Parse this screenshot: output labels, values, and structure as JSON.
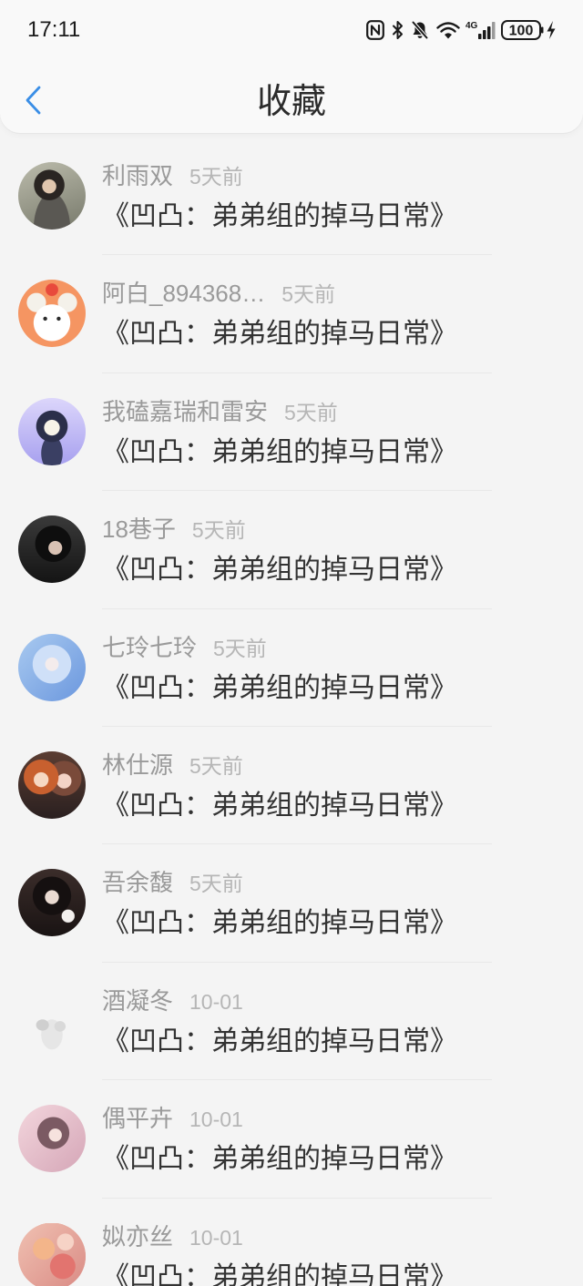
{
  "status_bar": {
    "time": "17:11",
    "network_label": "4G",
    "battery_level": "100",
    "icons": [
      "nfc-icon",
      "bluetooth-icon",
      "bell-mute-icon",
      "wifi-icon",
      "cell-signal-icon",
      "battery-icon",
      "charging-bolt-icon"
    ]
  },
  "header": {
    "title": "收藏",
    "back_icon": "chevron-left-icon"
  },
  "list": {
    "items": [
      {
        "name": "利雨双",
        "time": "5天前",
        "title": "《凹凸：弟弟组的掉马日常》"
      },
      {
        "name": "阿白_894368…",
        "time": "5天前",
        "title": "《凹凸：弟弟组的掉马日常》"
      },
      {
        "name": "我磕嘉瑞和雷安",
        "time": "5天前",
        "title": "《凹凸：弟弟组的掉马日常》"
      },
      {
        "name": "18巷子",
        "time": "5天前",
        "title": "《凹凸：弟弟组的掉马日常》"
      },
      {
        "name": "七玲七玲",
        "time": "5天前",
        "title": "《凹凸：弟弟组的掉马日常》"
      },
      {
        "name": "林仕源",
        "time": "5天前",
        "title": "《凹凸：弟弟组的掉马日常》"
      },
      {
        "name": "吾余馥",
        "time": "5天前",
        "title": "《凹凸：弟弟组的掉马日常》"
      },
      {
        "name": "酒凝冬",
        "time": "10-01",
        "title": "《凹凸：弟弟组的掉马日常》"
      },
      {
        "name": "偶平卉",
        "time": "10-01",
        "title": "《凹凸：弟弟组的掉马日常》"
      },
      {
        "name": "姒亦丝",
        "time": "10-01",
        "title": "《凹凸：弟弟组的掉马日常》"
      }
    ]
  },
  "theme": {
    "accent": "#3a8ee6",
    "page_background": "#f4f4f4",
    "header_background": "#f9f9f9",
    "text_primary": "#333333",
    "text_secondary": "#9a9a9a",
    "text_muted": "#b6b6b6",
    "divider": "#e8e8e8",
    "status_icon": "#1a1a1a"
  }
}
